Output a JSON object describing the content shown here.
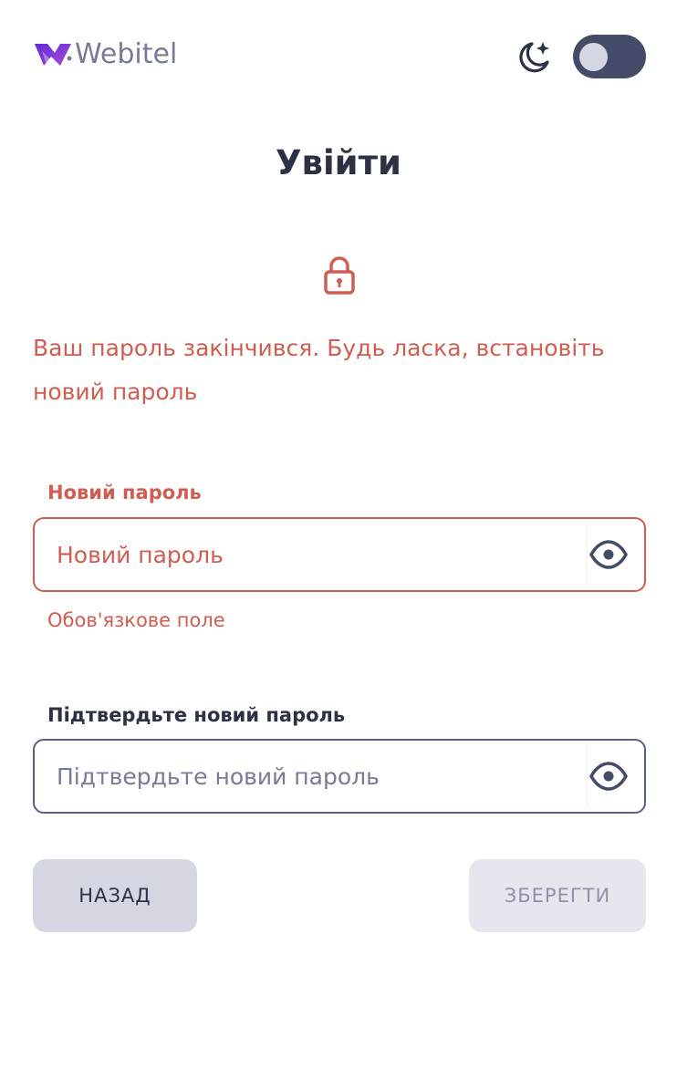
{
  "header": {
    "logo_text": "Webitel",
    "theme_toggle_on": false
  },
  "title": "Увійти",
  "warning": "Ваш пароль закінчився. Будь ласка, встановіть новий пароль",
  "new_password": {
    "label": "Новий пароль",
    "placeholder": "Новий пароль",
    "value": "",
    "error": "Обов'язкове поле"
  },
  "confirm_password": {
    "label": "Підтвердьте новий пароль",
    "placeholder": "Підтвердьте новий пароль",
    "value": ""
  },
  "buttons": {
    "back": "НАЗАД",
    "save": "ЗБЕРЕГТИ"
  },
  "colors": {
    "error": "#d05d54",
    "text": "#2c3144",
    "toggle_bg": "#434b68",
    "logo_gradient_start": "#5a2bd6",
    "logo_gradient_end": "#b04ad8"
  },
  "icons": {
    "theme": "moon-stars-icon",
    "lock": "lock-icon",
    "password_visibility": "eye-icon"
  }
}
